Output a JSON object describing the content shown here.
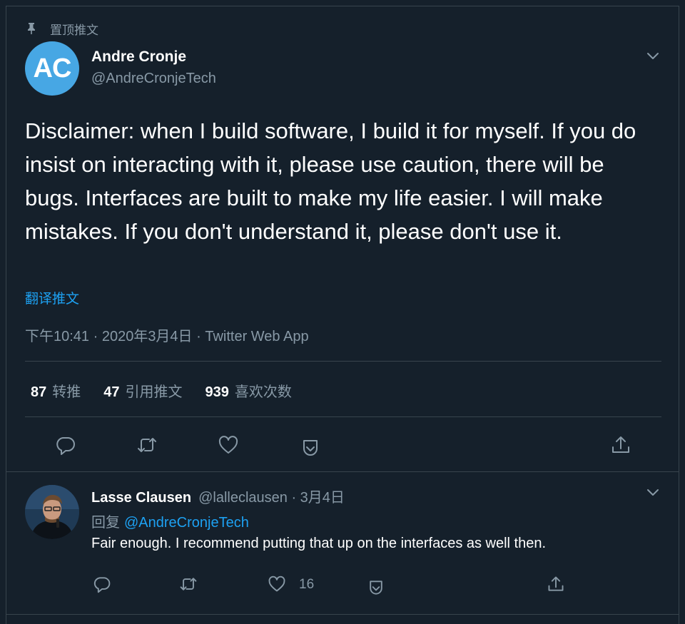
{
  "pinned": {
    "label": "置顶推文",
    "icon": "pin-icon"
  },
  "tweet": {
    "avatar_text": "AC",
    "avatar_color": "#47a7e4",
    "author_name": "Andre Cronje",
    "author_handle": "@AndreCronjeTech",
    "text": "Disclaimer: when I build software, I build it for myself. If you do insist on interacting with it, please use caution, there will be bugs. Interfaces are built to make my life easier. I will make mistakes. If you don't understand it, please don't use it.",
    "translate_label": "翻译推文",
    "meta": "下午10:41 · 2020年3月4日 · Twitter Web App",
    "stats": [
      {
        "count": "87",
        "label": "转推"
      },
      {
        "count": "47",
        "label": "引用推文"
      },
      {
        "count": "939",
        "label": "喜欢次数"
      }
    ]
  },
  "reply": {
    "author_name": "Lasse Clausen",
    "author_handle": "@lalleclausen",
    "date": "· 3月4日",
    "reply_prefix": "回复",
    "reply_to": "@AndreCronjeTech",
    "text": "Fair enough. I recommend putting that up on the interfaces as well then.",
    "like_count": "16"
  },
  "colors": {
    "background": "#15202b",
    "border": "#38444d",
    "muted": "#8899a6",
    "accent": "#1da1f2"
  }
}
